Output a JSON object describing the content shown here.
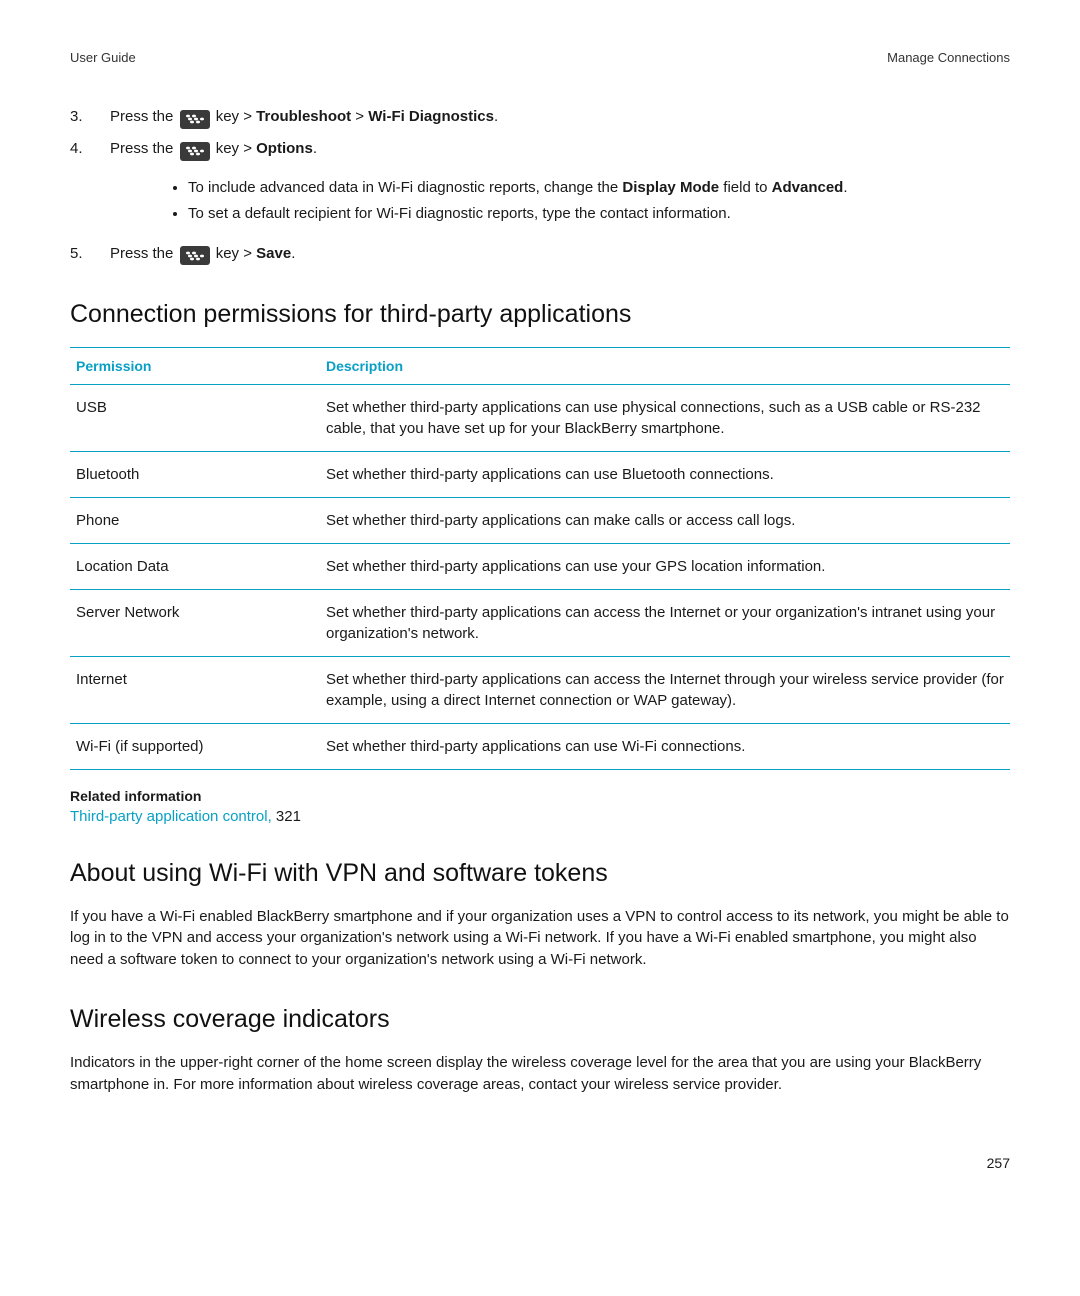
{
  "header": {
    "left": "User Guide",
    "right": "Manage Connections"
  },
  "steps": [
    {
      "num": "3.",
      "parts": [
        "Press the ",
        "KEY",
        " key > ",
        {
          "b": "Troubleshoot"
        },
        " > ",
        {
          "b": "Wi-Fi Diagnostics"
        },
        "."
      ]
    },
    {
      "num": "4.",
      "parts": [
        "Press the ",
        "KEY",
        " key > ",
        {
          "b": "Options"
        },
        "."
      ],
      "sub": [
        [
          "To include advanced data in Wi-Fi diagnostic reports, change the ",
          {
            "b": "Display Mode"
          },
          " field to ",
          {
            "b": "Advanced"
          },
          "."
        ],
        [
          "To set a default recipient for Wi-Fi diagnostic reports, type the contact information."
        ]
      ]
    },
    {
      "num": "5.",
      "parts": [
        "Press the ",
        "KEY",
        " key > ",
        {
          "b": "Save"
        },
        "."
      ]
    }
  ],
  "section1_title": "Connection permissions for third-party applications",
  "table": {
    "headers": [
      "Permission",
      "Description"
    ],
    "rows": [
      [
        "USB",
        "Set whether third-party applications can use physical connections, such as a USB cable or RS-232 cable, that you have set up for your BlackBerry smartphone."
      ],
      [
        "Bluetooth",
        "Set whether third-party applications can use Bluetooth connections."
      ],
      [
        "Phone",
        "Set whether third-party applications can make calls or access call logs."
      ],
      [
        "Location Data",
        "Set whether third-party applications can use your GPS location information."
      ],
      [
        "Server Network",
        "Set whether third-party applications can access the Internet or your organization's intranet using your organization's network."
      ],
      [
        "Internet",
        "Set whether third-party applications can access the Internet through your wireless service provider (for example, using a direct Internet connection or WAP gateway)."
      ],
      [
        "Wi-Fi (if supported)",
        "Set whether third-party applications can use Wi-Fi connections."
      ]
    ]
  },
  "related": {
    "header": "Related information",
    "link_text": "Third-party application control,",
    "page_ref": " 321"
  },
  "section2_title": "About using Wi-Fi with VPN and software tokens",
  "section2_body": "If you have a Wi-Fi enabled BlackBerry smartphone and if your organization uses a VPN to control access to its network, you might be able to log in to the VPN and access your organization's network using a Wi-Fi network. If you have a Wi-Fi enabled smartphone, you might also need a software token to connect to your organization's network using a Wi-Fi network.",
  "section3_title": "Wireless coverage indicators",
  "section3_body": "Indicators in the upper-right corner of the home screen display the wireless coverage level for the area that you are using your BlackBerry smartphone in. For more information about wireless coverage areas, contact your wireless service provider.",
  "page_number": "257"
}
